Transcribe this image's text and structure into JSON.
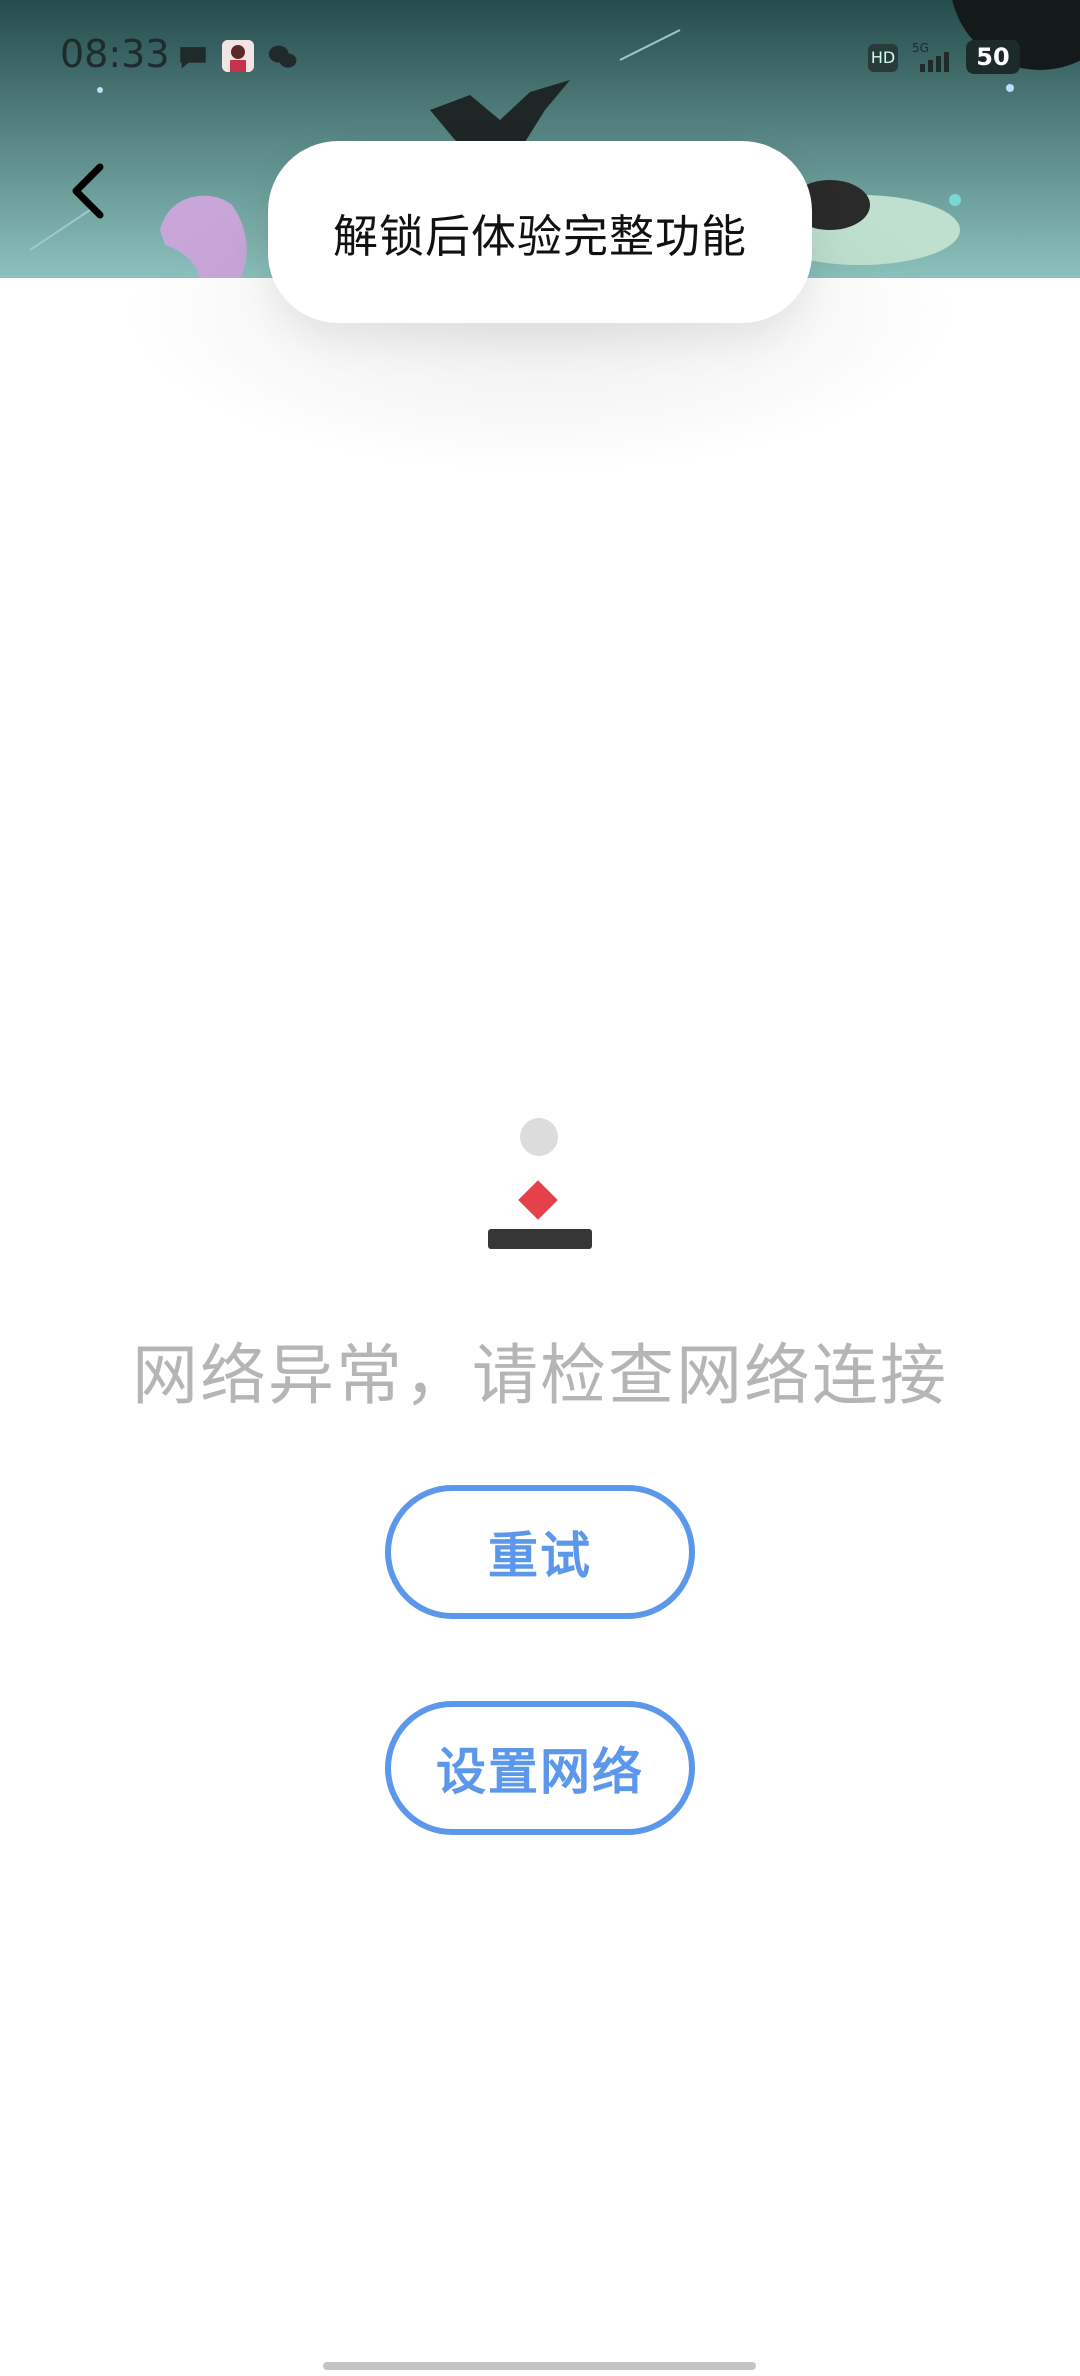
{
  "status_bar": {
    "time": "08:33",
    "hd_label": "HD",
    "network_label": "5G",
    "battery": "50",
    "icons": [
      "chat-bubble-icon",
      "profile-icon",
      "wechat-icon",
      "signal-icon",
      "battery-icon"
    ]
  },
  "header": {
    "back_icon": "chevron-left-icon"
  },
  "toast": {
    "message": "解锁后体验完整功能"
  },
  "error": {
    "message": "网络异常，请检查网络连接",
    "illustration_colors": {
      "dot": "#dcdcdc",
      "diamond": "#e5414b",
      "bar": "#363636"
    }
  },
  "actions": {
    "retry_label": "重试",
    "settings_label": "设置网络",
    "accent_color": "#5b97ea"
  }
}
